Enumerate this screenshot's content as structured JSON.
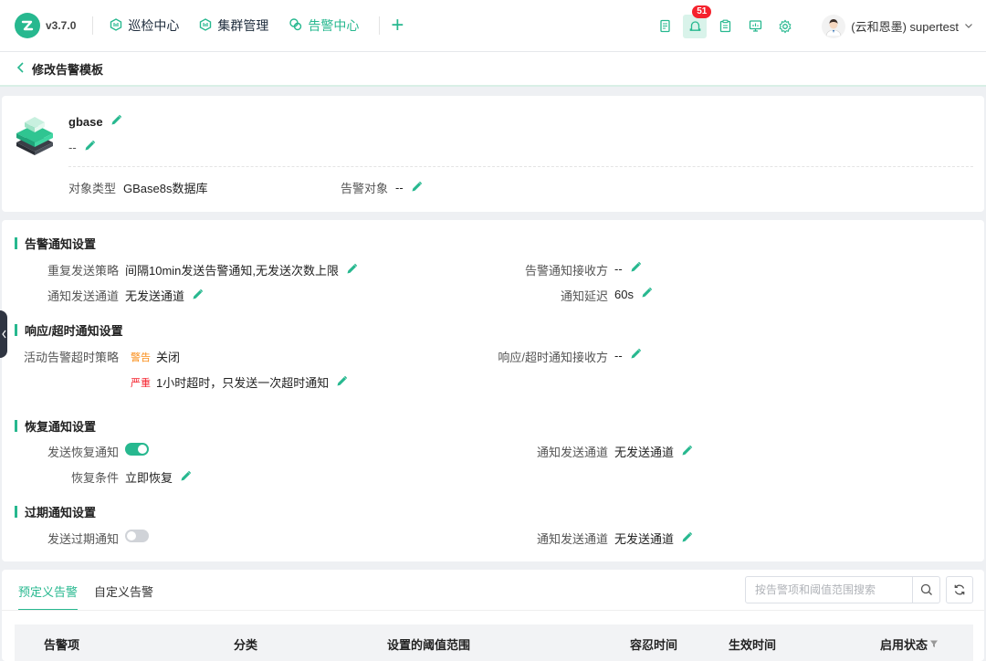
{
  "topbar": {
    "version": "v3.7.0",
    "nav": [
      {
        "label": "巡检中心"
      },
      {
        "label": "集群管理"
      },
      {
        "label": "告警中心"
      }
    ],
    "plus": "+",
    "badge_count": "51",
    "user": "(云和恩墨) supertest"
  },
  "subheader": {
    "title": "修改告警模板"
  },
  "object": {
    "name": "gbase",
    "desc": "--",
    "type_label": "对象类型",
    "type_value": "GBase8s数据库",
    "target_label": "告警对象",
    "target_value": "--"
  },
  "notify": {
    "title": "告警通知设置",
    "repeat_label": "重复发送策略",
    "repeat_value": "间隔10min发送告警通知,无发送次数上限",
    "receiver_label": "告警通知接收方",
    "receiver_value": "--",
    "channel_label": "通知发送通道",
    "channel_value": "无发送通道",
    "delay_label": "通知延迟",
    "delay_value": "60s"
  },
  "timeout": {
    "title": "响应/超时通知设置",
    "policy_label": "活动告警超时策略",
    "warn_tag": "警告",
    "warn_value": "关闭",
    "crit_tag": "严重",
    "crit_value": "1小时超时，只发送一次超时通知",
    "receiver_label": "响应/超时通知接收方",
    "receiver_value": "--"
  },
  "recovery": {
    "title": "恢复通知设置",
    "send_label": "发送恢复通知",
    "send_enabled": true,
    "channel_label": "通知发送通道",
    "channel_value": "无发送通道",
    "condition_label": "恢复条件",
    "condition_value": "立即恢复"
  },
  "expire": {
    "title": "过期通知设置",
    "send_label": "发送过期通知",
    "send_enabled": false,
    "channel_label": "通知发送通道",
    "channel_value": "无发送通道"
  },
  "rules": {
    "tabs": [
      {
        "label": "预定义告警",
        "active": true
      },
      {
        "label": "自定义告警",
        "active": false
      }
    ],
    "search_placeholder": "按告警项和阈值范围搜索",
    "columns": [
      "告警项",
      "分类",
      "设置的阈值范围",
      "容忍时间",
      "生效时间",
      "启用状态"
    ]
  },
  "colors": {
    "accent": "#27b88f",
    "badge": "#f5222d",
    "warn": "#fa8c16",
    "critical": "#f5222d"
  },
  "icons": [
    "logo-icon",
    "inspection-icon",
    "cluster-icon",
    "alarm-icon",
    "plus-icon",
    "document-icon",
    "bell-icon",
    "clipboard-icon",
    "monitor-icon",
    "settings-icon",
    "avatar",
    "chevron-down-icon",
    "back-chevron-icon",
    "edit-icon",
    "search-icon",
    "refresh-icon",
    "filter-icon"
  ]
}
